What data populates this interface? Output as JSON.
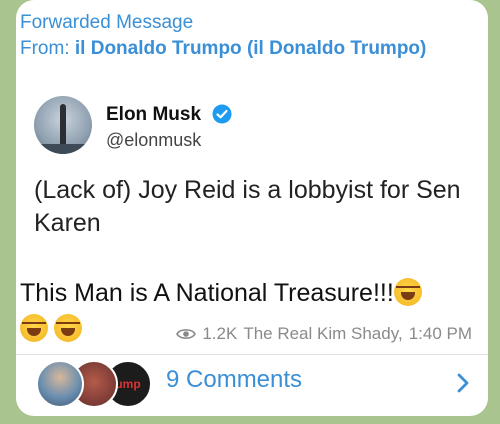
{
  "forward": {
    "title": "Forwarded Message",
    "from_prefix": "From: ",
    "from_name": "il Donaldo Trumpo (il Donaldo Trumpo)"
  },
  "tweet": {
    "name": "Elon Musk",
    "handle": "@elonmusk",
    "text": "(Lack of) Joy Reid is a lobbyist for Sen Karen"
  },
  "message": {
    "text": "This Man is A National Treasure!!!",
    "views": "1.2K",
    "author": "The Real Kim Shady,",
    "time": "1:40 PM"
  },
  "comments": {
    "label": "9 Comments",
    "avatar3_text": "ump"
  },
  "colors": {
    "link": "#3a8fd6",
    "background": "#a9c48f",
    "verified": "#1d9bf0"
  }
}
